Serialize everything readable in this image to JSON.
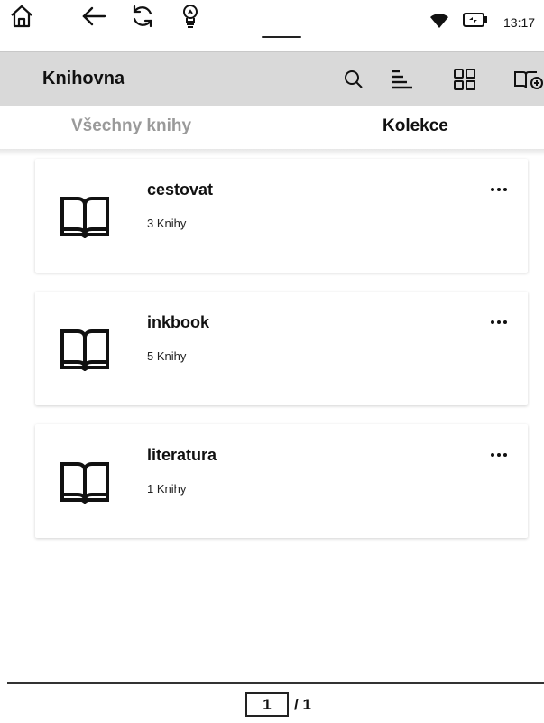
{
  "status_bar": {
    "icons": [
      "home-icon",
      "back-arrow-icon",
      "sync-icon",
      "light-bulb-icon",
      "wifi-icon",
      "battery-charging-icon"
    ],
    "time": "13:17"
  },
  "app_bar": {
    "title": "Knihovna",
    "icons": [
      "search-icon",
      "sort-icon",
      "grid-view-icon",
      "add-book-icon"
    ]
  },
  "tabs": [
    {
      "label": "Všechny knihy",
      "active": false
    },
    {
      "label": "Kolekce",
      "active": true
    }
  ],
  "collections": [
    {
      "name": "cestovat",
      "count": "3 Knihy"
    },
    {
      "name": "inkbook",
      "count": "5 Knihy"
    },
    {
      "name": "literatura",
      "count": "1 Knihy"
    }
  ],
  "pagination": {
    "current": "1",
    "total": "/ 1"
  }
}
